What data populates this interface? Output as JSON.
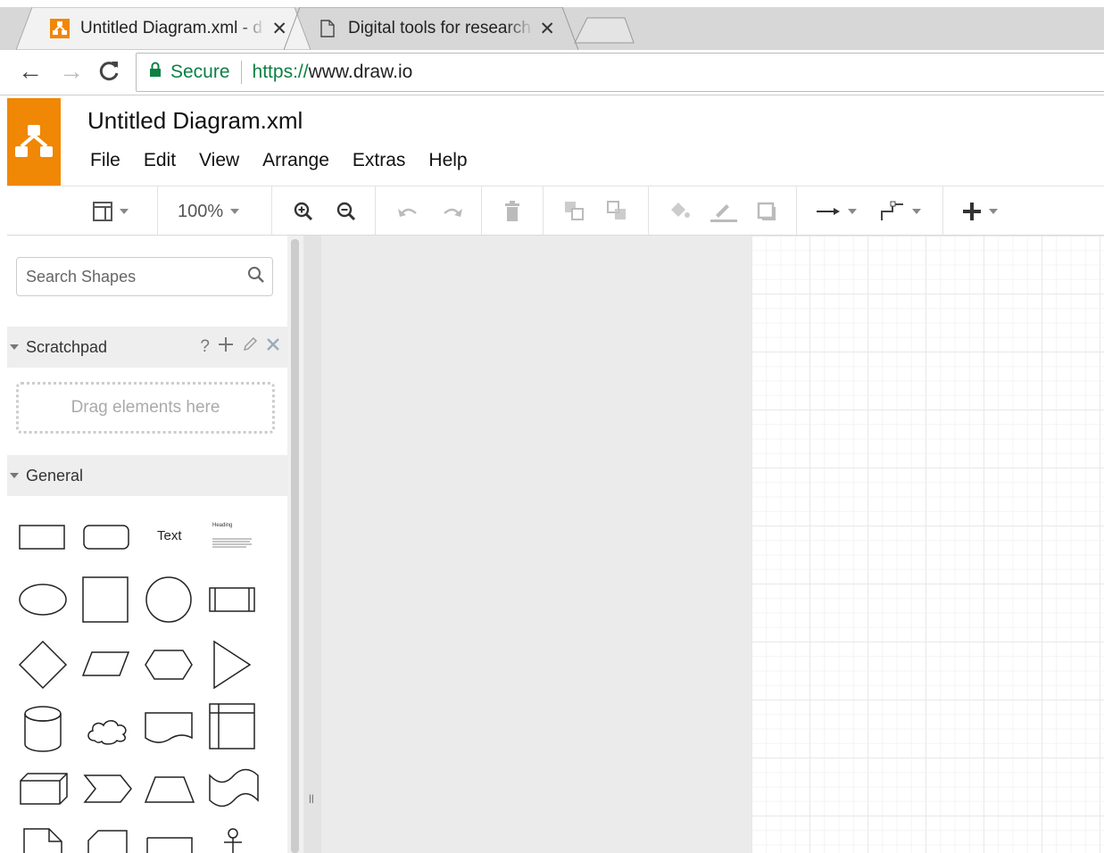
{
  "browser": {
    "tabs": [
      {
        "title": "Untitled Diagram.xml - d",
        "active": true,
        "favicon": "drawio-logo-icon"
      },
      {
        "title": "Digital tools for research",
        "active": false,
        "favicon": "document-icon"
      }
    ],
    "close_glyph": "✕",
    "secure_label": "Secure",
    "url_scheme": "https://",
    "url_host": "www.draw.io"
  },
  "app": {
    "title": "Untitled Diagram.xml",
    "menu": [
      "File",
      "Edit",
      "View",
      "Arrange",
      "Extras",
      "Help"
    ],
    "brand_color": "#f08705"
  },
  "toolbar": {
    "zoom": "100%"
  },
  "sidebar": {
    "search_placeholder": "Search Shapes",
    "scratchpad_label": "Scratchpad",
    "scratchpad_help": "?",
    "scratchpad_drop": "Drag elements here",
    "general_label": "General",
    "text_shape_label": "Text",
    "heading_shape_label": "Heading"
  }
}
